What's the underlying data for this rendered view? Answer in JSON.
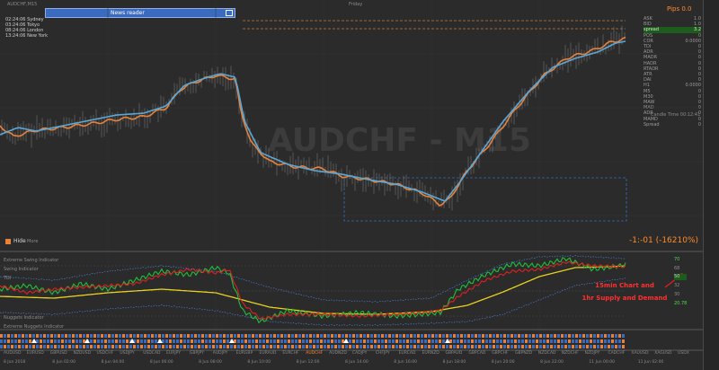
{
  "window": {
    "title": "AUDCHF,M15"
  },
  "top": {
    "center_label": "Friday"
  },
  "news_bar": {
    "label": "News reader"
  },
  "sessions": [
    "Sydney",
    "Tokyo",
    "London",
    "New York"
  ],
  "session_times": [
    "02:24:06",
    "03:24:06",
    "08:24:06",
    "13:24:06"
  ],
  "pips": {
    "label": "Pips",
    "value": "0.0"
  },
  "info_rows": [
    {
      "k": "ASK",
      "v": "1.0"
    },
    {
      "k": "BID",
      "v": "1.0"
    },
    {
      "k": "spread",
      "v": "3.2"
    },
    {
      "k": "POS",
      "v": "0"
    },
    {
      "k": "COR",
      "v": "0.0000"
    },
    {
      "k": "TDI",
      "v": "0"
    },
    {
      "k": "ADR",
      "v": "0"
    },
    {
      "k": "MADR",
      "v": "0"
    },
    {
      "k": "HADR",
      "v": "0"
    },
    {
      "k": "RTADR",
      "v": "0"
    },
    {
      "k": "ATR",
      "v": "0"
    },
    {
      "k": "DAI",
      "v": "0"
    },
    {
      "k": "H1",
      "v": "0.0000"
    },
    {
      "k": "M5",
      "v": "0"
    },
    {
      "k": "M30",
      "v": "0"
    },
    {
      "k": "MAW",
      "v": "0"
    },
    {
      "k": "MAD",
      "v": "0"
    },
    {
      "k": "ADR",
      "v": "0"
    },
    {
      "k": "MAMD",
      "v": "0"
    },
    {
      "k": "Spread",
      "v": "0"
    }
  ],
  "candle_time": {
    "label": "Candle Time",
    "value": "00:12:41"
  },
  "watermark": "AUDCHF - M15",
  "hide_buttons": {
    "hide": "Hide",
    "more": "More"
  },
  "countdown": "-1:-01 (-16210%)",
  "indicator_labels": {
    "swing1": "Extreme Swing Indicator",
    "swing2": "Swing Indicator",
    "tdi_label": "TDI",
    "nuggets": "Nuggets Indicator",
    "bottom": "Extreme Nuggets Indicator"
  },
  "annotation": {
    "line1": "15min Chart and",
    "line2": "1hr Supply and Demand"
  },
  "right_tags": [
    "70",
    "68",
    "50",
    "32",
    "30",
    "20.78"
  ],
  "bottom_axis": [
    "AUDUSD",
    "EURUSD",
    "GBPUSD",
    "NZDUSD",
    "USDCHF",
    "USDJPY",
    "USDCAD",
    "EURJPY",
    "GBPJPY",
    "AUDJPY",
    "EURGBP",
    "EURAUD",
    "EURCHF",
    "AUDCHF",
    "AUDNZD",
    "CADJPY",
    "CHFJPY",
    "EURCAD",
    "EURNZD",
    "GBPAUD",
    "GBPCAD",
    "GBPCHF",
    "GBPNZD",
    "NZDCAD",
    "NZDCHF",
    "NZDJPY",
    "CADCHF",
    "XAUUSD",
    "XAGUSD",
    "USDX"
  ],
  "time_axis": [
    "8 Jun 2018",
    "8 Jun 02:00",
    "8 Jun 04:00",
    "8 Jun 06:00",
    "8 Jun 08:00",
    "8 Jun 10:00",
    "8 Jun 12:00",
    "8 Jun 14:00",
    "8 Jun 16:00",
    "8 Jun 18:00",
    "8 Jun 20:00",
    "8 Jun 22:00",
    "11 Jun 00:00",
    "11 Jun 02:00"
  ],
  "colors": {
    "orange": "#e8823a",
    "blue": "#5aa7d8",
    "green": "#1fbf3a",
    "red": "#e02020",
    "yellow": "#e8d21a",
    "accent_text": "#ff8a2a",
    "annotation": "#ff3030"
  }
}
